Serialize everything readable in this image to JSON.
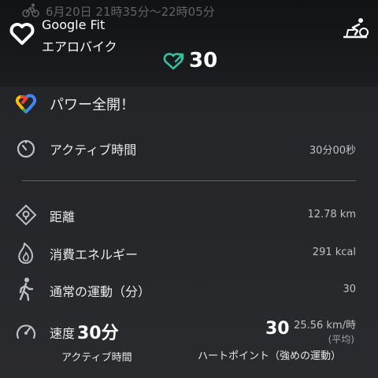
{
  "header": {
    "date_range": "6月20日 21時35分～22時05分",
    "app_name": "Google Fit",
    "activity_name": "エアロバイク",
    "heart_points": "30"
  },
  "achievement": {
    "label": "パワー全開！"
  },
  "active_time": {
    "label": "アクティブ時間",
    "value": "30分00秒"
  },
  "metrics": {
    "distance": {
      "label": "距離",
      "value": "12.78 km"
    },
    "energy": {
      "label": "消費エネルギー",
      "value": "291 kcal"
    },
    "move_minutes": {
      "label": "通常の運動（分）",
      "value": "30"
    },
    "speed": {
      "label": "速度",
      "value": "25.56 km/時",
      "note": "(平均)"
    }
  },
  "summary": {
    "active_value": "30分",
    "active_caption": "アクティブ時間",
    "hp_value": "30",
    "hp_caption": "ハートポイント（強めの運動）"
  },
  "colors": {
    "background": "#202124",
    "teal": "#34c0a0",
    "google_blue": "#4285f4",
    "google_red": "#ea4335",
    "google_yellow": "#fbbc04",
    "google_green": "#34a853"
  },
  "icons": {
    "logo": "google-fit-heart-icon",
    "activity": "stationary-bike-icon",
    "heart_points": "heart-arrow-icon",
    "achievement": "google-fit-color-heart-icon",
    "timer": "timer-icon",
    "distance": "location-pin-icon",
    "energy": "flame-icon",
    "walking": "walking-person-icon",
    "speed": "speedometer-icon"
  }
}
